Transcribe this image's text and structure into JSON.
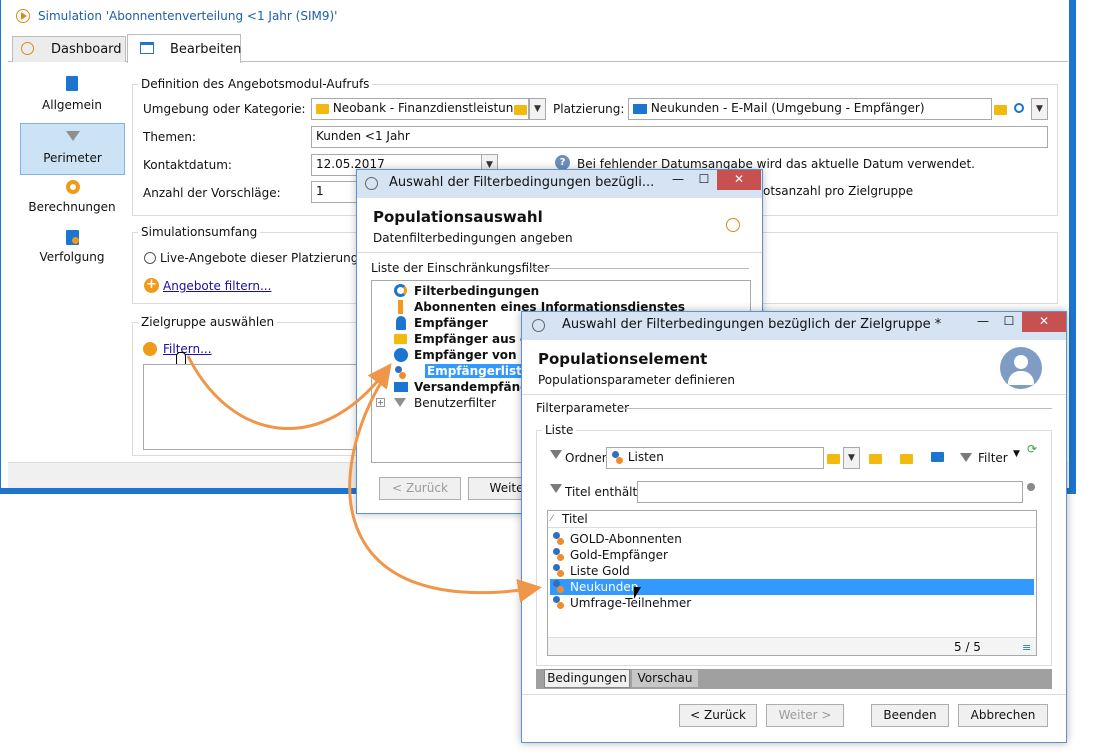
{
  "main_window": {
    "title": "Simulation 'Abonnentenverteilung <1 Jahr  (SIM9)'",
    "tabs": [
      {
        "label": "Dashboard"
      },
      {
        "label": "Bearbeiten"
      }
    ],
    "sidebar": [
      {
        "label": "Allgemein",
        "icon": "clipboard-icon"
      },
      {
        "label": "Perimeter",
        "icon": "funnel-icon",
        "selected": true
      },
      {
        "label": "Berechnungen",
        "icon": "gear-icon"
      },
      {
        "label": "Verfolgung",
        "icon": "tracking-icon"
      }
    ],
    "definition": {
      "title": "Definition des Angebotsmodul-Aufrufs",
      "env_label": "Umgebung oder Kategorie:",
      "env_value": "Neobank - Finanzdienstleistung",
      "placement_label": "Platzierung:",
      "placement_value": "Neukunden - E-Mail (Umgebung - Empfänger)",
      "themes_label": "Themen:",
      "themes_value": "Kunden <1 Jahr",
      "contact_date_label": "Kontaktdatum:",
      "contact_date_value": "12.05.2017",
      "date_hint": "Bei fehlender Datumsangabe wird das aktuelle Datum verwendet.",
      "proposals_label": "Anzahl der Vorschläge:",
      "proposals_value": "1",
      "target_hint": "otsanzahl pro Zielgruppe"
    },
    "scope": {
      "title": "Simulationsumfang",
      "radio_label": "Live-Angebote dieser Platzierung",
      "filter_link": "Angebote filtern..."
    },
    "target": {
      "title": "Zielgruppe auswählen",
      "filter_link": "Filtern..."
    }
  },
  "dialog1": {
    "title": "Auswahl der Filterbedingungen bezügli...",
    "heading": "Populationsauswahl",
    "subheading": "Datenfilterbedingungen angeben",
    "list_title": "Liste der Einschränkungsfilter",
    "items": [
      {
        "label": "Filterbedingungen"
      },
      {
        "label": "Abonnenten eines Informationsdienstes"
      },
      {
        "label": "Empfänger"
      },
      {
        "label": "Empfänger aus eine"
      },
      {
        "label": "Empfänger von Ser"
      },
      {
        "label": "Empfängerliste",
        "selected": true
      },
      {
        "label": "Versandempfänger"
      },
      {
        "label": "Benutzerfilter"
      }
    ],
    "back_button": "< Zurück",
    "next_button": "Weiter"
  },
  "dialog2": {
    "title": "Auswahl der Filterbedingungen bezüglich der Zielgruppe *",
    "heading": "Populationselement",
    "subheading": "Populationsparameter definieren",
    "filter_params_title": "Filterparameter",
    "list_group_title": "Liste",
    "folder_label": "Ordner:",
    "folder_value": "Listen",
    "filter_button": "Filter",
    "title_contains_label": "Titel enthält:",
    "title_contains_value": "",
    "column_header": "Titel",
    "rows": [
      {
        "label": "GOLD-Abonnenten"
      },
      {
        "label": "Gold-Empfänger"
      },
      {
        "label": "Liste Gold"
      },
      {
        "label": "Neukunden",
        "selected": true
      },
      {
        "label": "Umfrage-Teilnehmer"
      }
    ],
    "count": "5 / 5",
    "tabs": [
      {
        "label": "Bedingungen"
      },
      {
        "label": "Vorschau"
      }
    ],
    "back_button": "< Zurück",
    "next_button": "Weiter >",
    "finish_button": "Beenden",
    "cancel_button": "Abbrechen"
  },
  "colors": {
    "accent_blue": "#1c75cf",
    "selection": "#3399ff",
    "close_red": "#c75050",
    "arrow_orange": "#f0964a",
    "dialog_title_bg": "#d5e3f3"
  }
}
